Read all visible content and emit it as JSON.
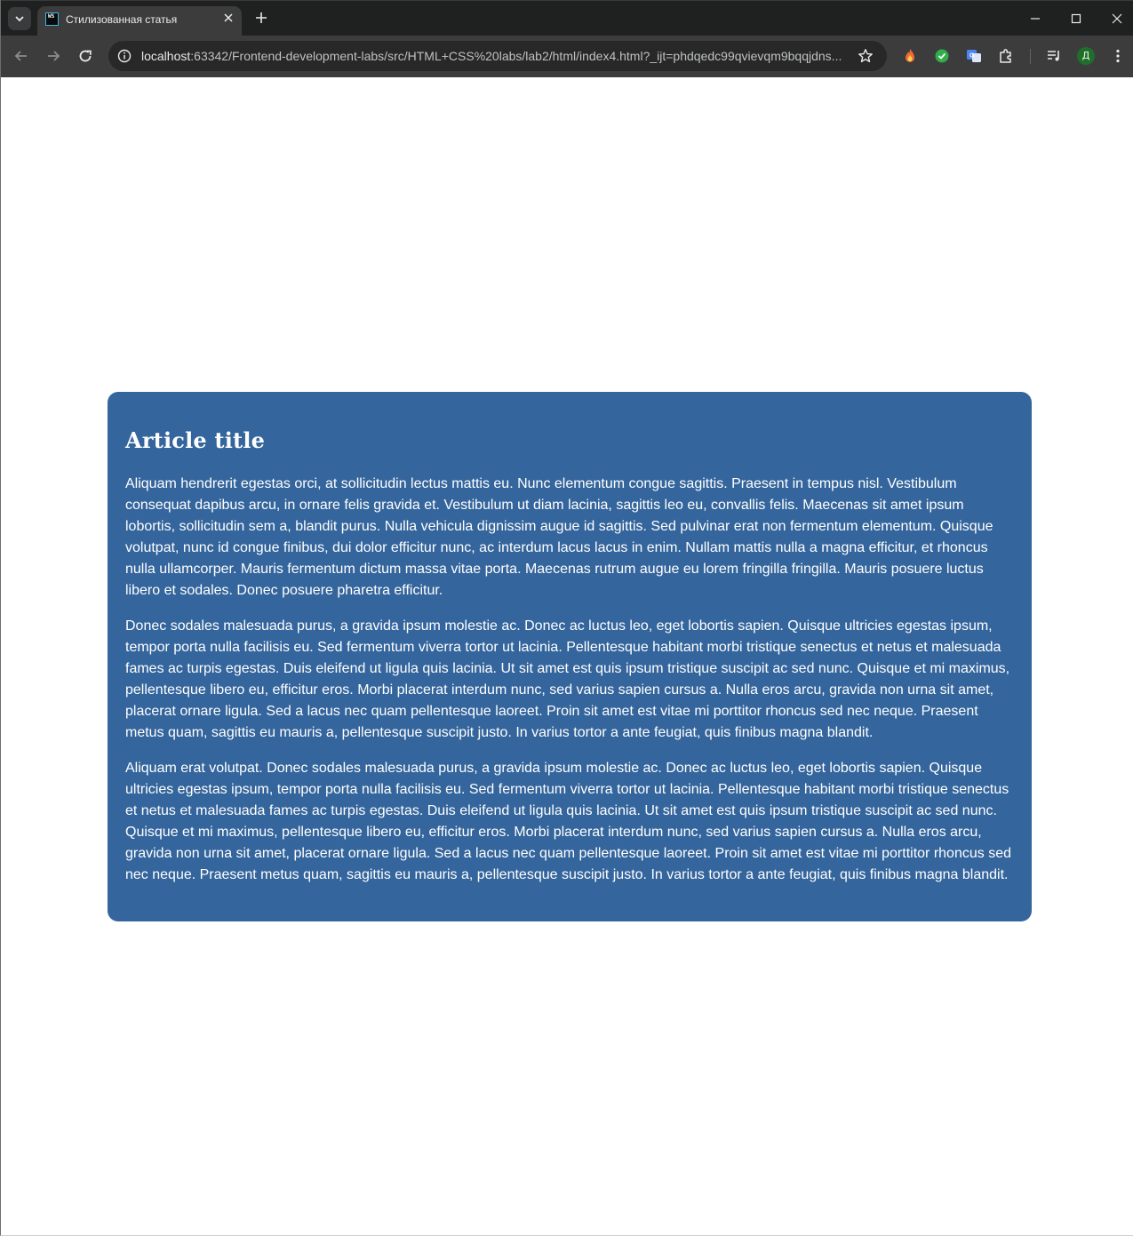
{
  "browser": {
    "tab": {
      "favicon_text": "WS",
      "title": "Стилизованная статья"
    },
    "address": {
      "host": "localhost",
      "rest": ":63342/Frontend-development-labs/src/HTML+CSS%20labs/lab2/html/index4.html?_ijt=phdqedc99qvievqm9bqqjdns..."
    },
    "profile_initial": "Д",
    "icons": {
      "tab_search": "chevron-down-icon",
      "close": "close-icon",
      "new_tab": "plus-icon",
      "back": "arrow-left-icon",
      "forward": "arrow-right-icon",
      "reload": "reload-icon",
      "site_info": "info-icon",
      "bookmark": "star-icon",
      "extension_1": "fire-extension-icon",
      "extension_2": "green-check-extension-icon",
      "extension_3": "translate-extension-icon",
      "extensions": "puzzle-icon",
      "media": "media-queue-icon",
      "menu": "kebab-menu-icon"
    }
  },
  "article": {
    "title": "Article title",
    "paragraphs": [
      "Aliquam hendrerit egestas orci, at sollicitudin lectus mattis eu. Nunc elementum congue sagittis. Praesent in tempus nisl. Vestibulum consequat dapibus arcu, in ornare felis gravida et. Vestibulum ut diam lacinia, sagittis leo eu, convallis felis. Maecenas sit amet ipsum lobortis, sollicitudin sem a, blandit purus. Nulla vehicula dignissim augue id sagittis. Sed pulvinar erat non fermentum elementum. Quisque volutpat, nunc id congue finibus, dui dolor efficitur nunc, ac interdum lacus lacus in enim. Nullam mattis nulla a magna efficitur, et rhoncus nulla ullamcorper. Mauris fermentum dictum massa vitae porta. Maecenas rutrum augue eu lorem fringilla fringilla. Mauris posuere luctus libero et sodales. Donec posuere pharetra efficitur.",
      "Donec sodales malesuada purus, a gravida ipsum molestie ac. Donec ac luctus leo, eget lobortis sapien. Quisque ultricies egestas ipsum, tempor porta nulla facilisis eu. Sed fermentum viverra tortor ut lacinia. Pellentesque habitant morbi tristique senectus et netus et malesuada fames ac turpis egestas. Duis eleifend ut ligula quis lacinia. Ut sit amet est quis ipsum tristique suscipit ac sed nunc. Quisque et mi maximus, pellentesque libero eu, efficitur eros. Morbi placerat interdum nunc, sed varius sapien cursus a. Nulla eros arcu, gravida non urna sit amet, placerat ornare ligula. Sed a lacus nec quam pellentesque laoreet. Proin sit amet est vitae mi porttitor rhoncus sed nec neque. Praesent metus quam, sagittis eu mauris a, pellentesque suscipit justo. In varius tortor a ante feugiat, quis finibus magna blandit.",
      "Aliquam erat volutpat. Donec sodales malesuada purus, a gravida ipsum molestie ac. Donec ac luctus leo, eget lobortis sapien. Quisque ultricies egestas ipsum, tempor porta nulla facilisis eu. Sed fermentum viverra tortor ut lacinia. Pellentesque habitant morbi tristique senectus et netus et malesuada fames ac turpis egestas. Duis eleifend ut ligula quis lacinia. Ut sit amet est quis ipsum tristique suscipit ac sed nunc. Quisque et mi maximus, pellentesque libero eu, efficitur eros. Morbi placerat interdum nunc, sed varius sapien cursus a. Nulla eros arcu, gravida non urna sit amet, placerat ornare ligula. Sed a lacus nec quam pellentesque laoreet. Proin sit amet est vitae mi porttitor rhoncus sed nec neque. Praesent metus quam, sagittis eu mauris a, pellentesque suscipit justo. In varius tortor a ante feugiat, quis finibus magna blandit."
    ]
  },
  "colors": {
    "article_background": "#34659c",
    "article_text": "#ffffff",
    "browser_tabstrip": "#1f2020",
    "browser_toolbar": "#3c3c3c"
  }
}
